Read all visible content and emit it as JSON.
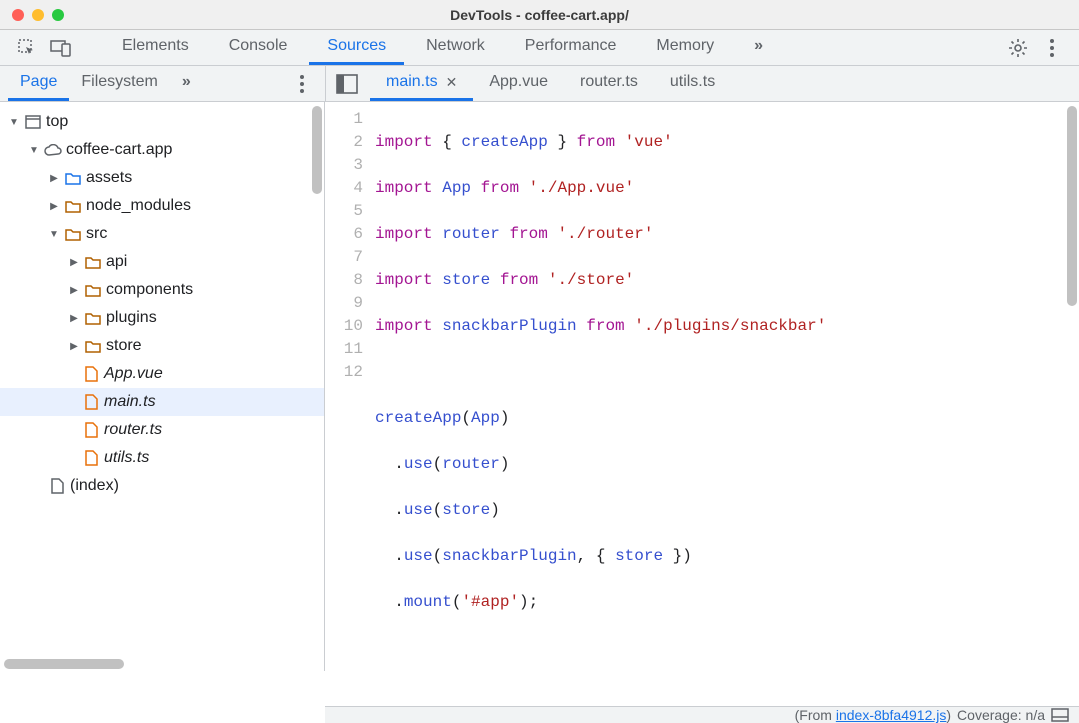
{
  "window": {
    "title": "DevTools - coffee-cart.app/"
  },
  "panel_tabs": [
    "Elements",
    "Console",
    "Sources",
    "Network",
    "Performance",
    "Memory"
  ],
  "panel_tabs_active": "Sources",
  "nav_tabs": [
    "Page",
    "Filesystem"
  ],
  "nav_tabs_active": "Page",
  "file_tabs": [
    {
      "label": "main.ts",
      "active": true,
      "closeable": true
    },
    {
      "label": "App.vue",
      "active": false,
      "closeable": false
    },
    {
      "label": "router.ts",
      "active": false,
      "closeable": false
    },
    {
      "label": "utils.ts",
      "active": false,
      "closeable": false
    }
  ],
  "tree": {
    "top": "top",
    "domain": "coffee-cart.app",
    "assets": "assets",
    "node_modules": "node_modules",
    "src": "src",
    "api": "api",
    "components": "components",
    "plugins": "plugins",
    "store": "store",
    "app_vue": "App.vue",
    "main_ts": "main.ts",
    "router_ts": "router.ts",
    "utils_ts": "utils.ts",
    "index": "(index)"
  },
  "code": {
    "lines": [
      "1",
      "2",
      "3",
      "4",
      "5",
      "6",
      "7",
      "8",
      "9",
      "10",
      "11",
      "12"
    ],
    "l1_a": "import",
    "l1_b": "createApp",
    "l1_c": "from",
    "l1_d": "'vue'",
    "l2_a": "import",
    "l2_b": "App",
    "l2_c": "from",
    "l2_d": "'./App.vue'",
    "l3_a": "import",
    "l3_b": "router",
    "l3_c": "from",
    "l3_d": "'./router'",
    "l4_a": "import",
    "l4_b": "store",
    "l4_c": "from",
    "l4_d": "'./store'",
    "l5_a": "import",
    "l5_b": "snackbarPlugin",
    "l5_c": "from",
    "l5_d": "'./plugins/snackbar'",
    "l7_a": "createApp",
    "l7_b": "App",
    "l8_a": "use",
    "l8_b": "router",
    "l9_a": "use",
    "l9_b": "store",
    "l10_a": "use",
    "l10_b": "snackbarPlugin",
    "l10_c": "store",
    "l11_a": "mount",
    "l11_b": "'#app'"
  },
  "footer": {
    "from_prefix": "(From ",
    "link": "index-8bfa4912.js",
    "from_suffix": ")",
    "coverage": " Coverage: n/a"
  }
}
